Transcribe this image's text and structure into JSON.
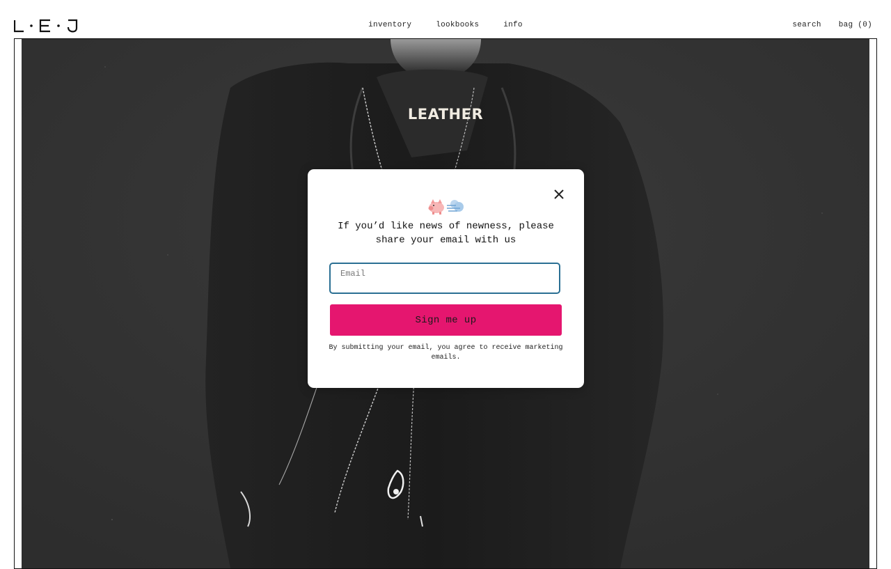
{
  "header": {
    "logo_text": "L·E·J",
    "nav": {
      "inventory": "inventory",
      "lookbooks": "lookbooks",
      "info": "info"
    },
    "search_label": "search",
    "bag_label": "bag (0)"
  },
  "hero": {
    "title": "LEATHER",
    "image_icon": "leather-jacket-photo"
  },
  "popup": {
    "emoji_icons": [
      "pig-icon",
      "wind-icon"
    ],
    "message": "If you’d like news of newness, please share your email with us",
    "email": {
      "placeholder": "Email",
      "value": ""
    },
    "submit_label": "Sign me up",
    "disclaimer": "By submitting your email, you agree to receive marketing emails.",
    "close_icon": "close-icon"
  },
  "colors": {
    "accent": "#e5166f",
    "input_border": "#2a6f93",
    "hero_background": "#343434",
    "hero_title": "#f1ece2"
  }
}
